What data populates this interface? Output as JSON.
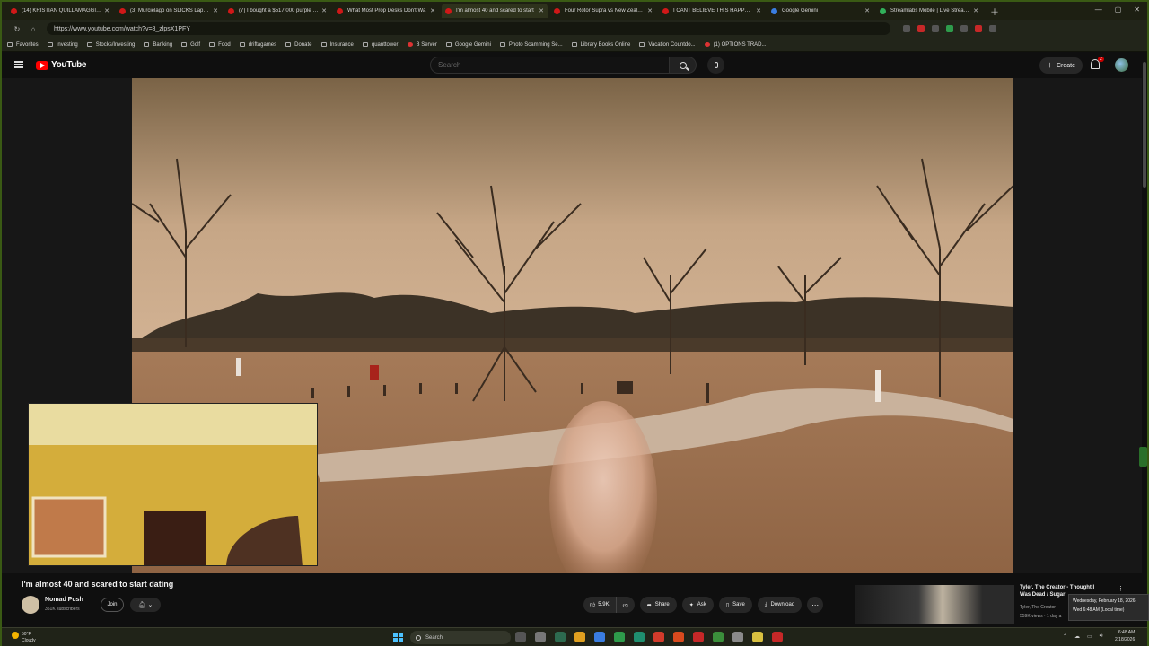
{
  "browser": {
    "tabs": [
      {
        "title": "(14) KRISTIAN QUILLAMAGGIE - M",
        "favicon": "youtube-icon",
        "active": false
      },
      {
        "title": "(3) Murcielago on SLICKS Laps the",
        "favicon": "youtube-icon",
        "active": false
      },
      {
        "title": "(7) I bought a $517,000 purple Fe",
        "favicon": "youtube-icon",
        "active": false
      },
      {
        "title": "What Most Prop Desks Don't Wa",
        "favicon": "youtube-icon",
        "active": false
      },
      {
        "title": "I'm almost 40 and scared to start",
        "favicon": "youtube-icon",
        "active": true
      },
      {
        "title": "Four Rotor Supra vs New Zealand",
        "favicon": "youtube-icon",
        "active": false
      },
      {
        "title": "I CANT BELIEVE THIS HAPPENED &",
        "favicon": "youtube-icon",
        "active": false
      },
      {
        "title": "Google Gemini",
        "favicon": "gemini-icon",
        "active": false
      },
      {
        "title": "Streamlabs Mobile | Live Streamin",
        "favicon": "streamlabs-icon",
        "active": false
      }
    ],
    "url": "https://www.youtube.com/watch?v=8_zlpsX1PFY",
    "bookmarks": [
      "Favorites",
      "Investing",
      "Stocks/Investing",
      "Banking",
      "Golf",
      "Food",
      "driftagames",
      "Donate",
      "Insurance",
      "quanttower",
      "B Server",
      "Google Gemini",
      "Photo Scamming Se...",
      "Library Books Online",
      "Vacation Countdo...",
      "(1) OPTIONS TRAD..."
    ]
  },
  "youtube": {
    "logo_text": "YouTube",
    "search_placeholder": "Search",
    "create_label": "Create",
    "notification_count": "2"
  },
  "video": {
    "title": "I'm almost 40 and scared to start dating",
    "channel": "Nomad Push",
    "subscribers": "351K subscribers",
    "join_label": "Join",
    "likes": "5.9K",
    "share_label": "Share",
    "ask_label": "Ask",
    "save_label": "Save",
    "download_label": "Download"
  },
  "recommendation": {
    "title": "Tyler, The Creator - Thought I Was Dead / Sugar",
    "channel": "Tyler, The Creator",
    "meta": "559K views · 1 day a"
  },
  "tooltip": {
    "line1": "Wednesday, February 18, 2026",
    "line2": "Wed 6:48 AM (Local time)"
  },
  "taskbar": {
    "weather_temp": "50°F",
    "weather_desc": "Cloudy",
    "search_label": "Search",
    "time": "6:48 AM",
    "date": "2/18/2026"
  }
}
